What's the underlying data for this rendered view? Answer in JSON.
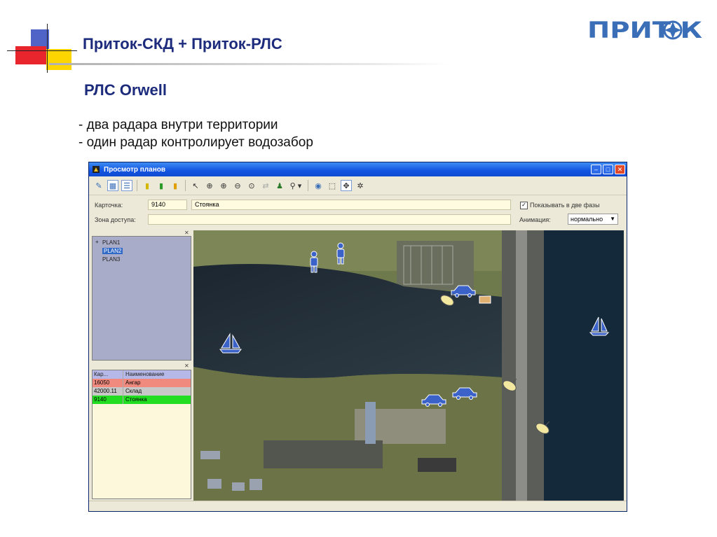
{
  "slide": {
    "title": "Приток-СКД + Приток-РЛС",
    "subtitle": "РЛС Orwell",
    "bullets": [
      "- два радара внутри территории",
      "- один радар контролирует водозабор"
    ],
    "logo_text": "ПРИТОК",
    "accent": "#1c2b7c"
  },
  "window": {
    "title": "Просмотр планов",
    "titlebar_color": "#1254e0",
    "buttons": [
      "minimize-icon",
      "maximize-icon",
      "close-icon"
    ]
  },
  "form": {
    "card_label": "Карточка:",
    "card_number": "9140",
    "card_name": "Стоянка",
    "zone_label": "Зона доступа:",
    "zone_value": "",
    "show_two_phases_label": "Показывать в две фазы",
    "show_two_phases_checked": true,
    "animation_label": "Анимация:",
    "animation_value": "нормально"
  },
  "tree": {
    "items": [
      {
        "label": "PLAN1",
        "selected": false
      },
      {
        "label": "PLAN2",
        "selected": true
      },
      {
        "label": "PLAN3",
        "selected": false
      }
    ]
  },
  "cards_table": {
    "headers": [
      "Кар...",
      "Наименование"
    ],
    "rows": [
      {
        "id": "16050",
        "name": "Ангар",
        "color": "#f08a7e"
      },
      {
        "id": "42000.11",
        "name": "Склад",
        "color": "#c8c8c8"
      },
      {
        "id": "9140",
        "name": "Стоянка",
        "color": "#22dd22"
      }
    ]
  },
  "map": {
    "icons": [
      "person-icon",
      "person-icon",
      "car-icon",
      "car-icon",
      "car-icon",
      "sailboat-icon",
      "sailboat-icon",
      "radar-icon",
      "radar-icon",
      "radar-icon"
    ]
  }
}
